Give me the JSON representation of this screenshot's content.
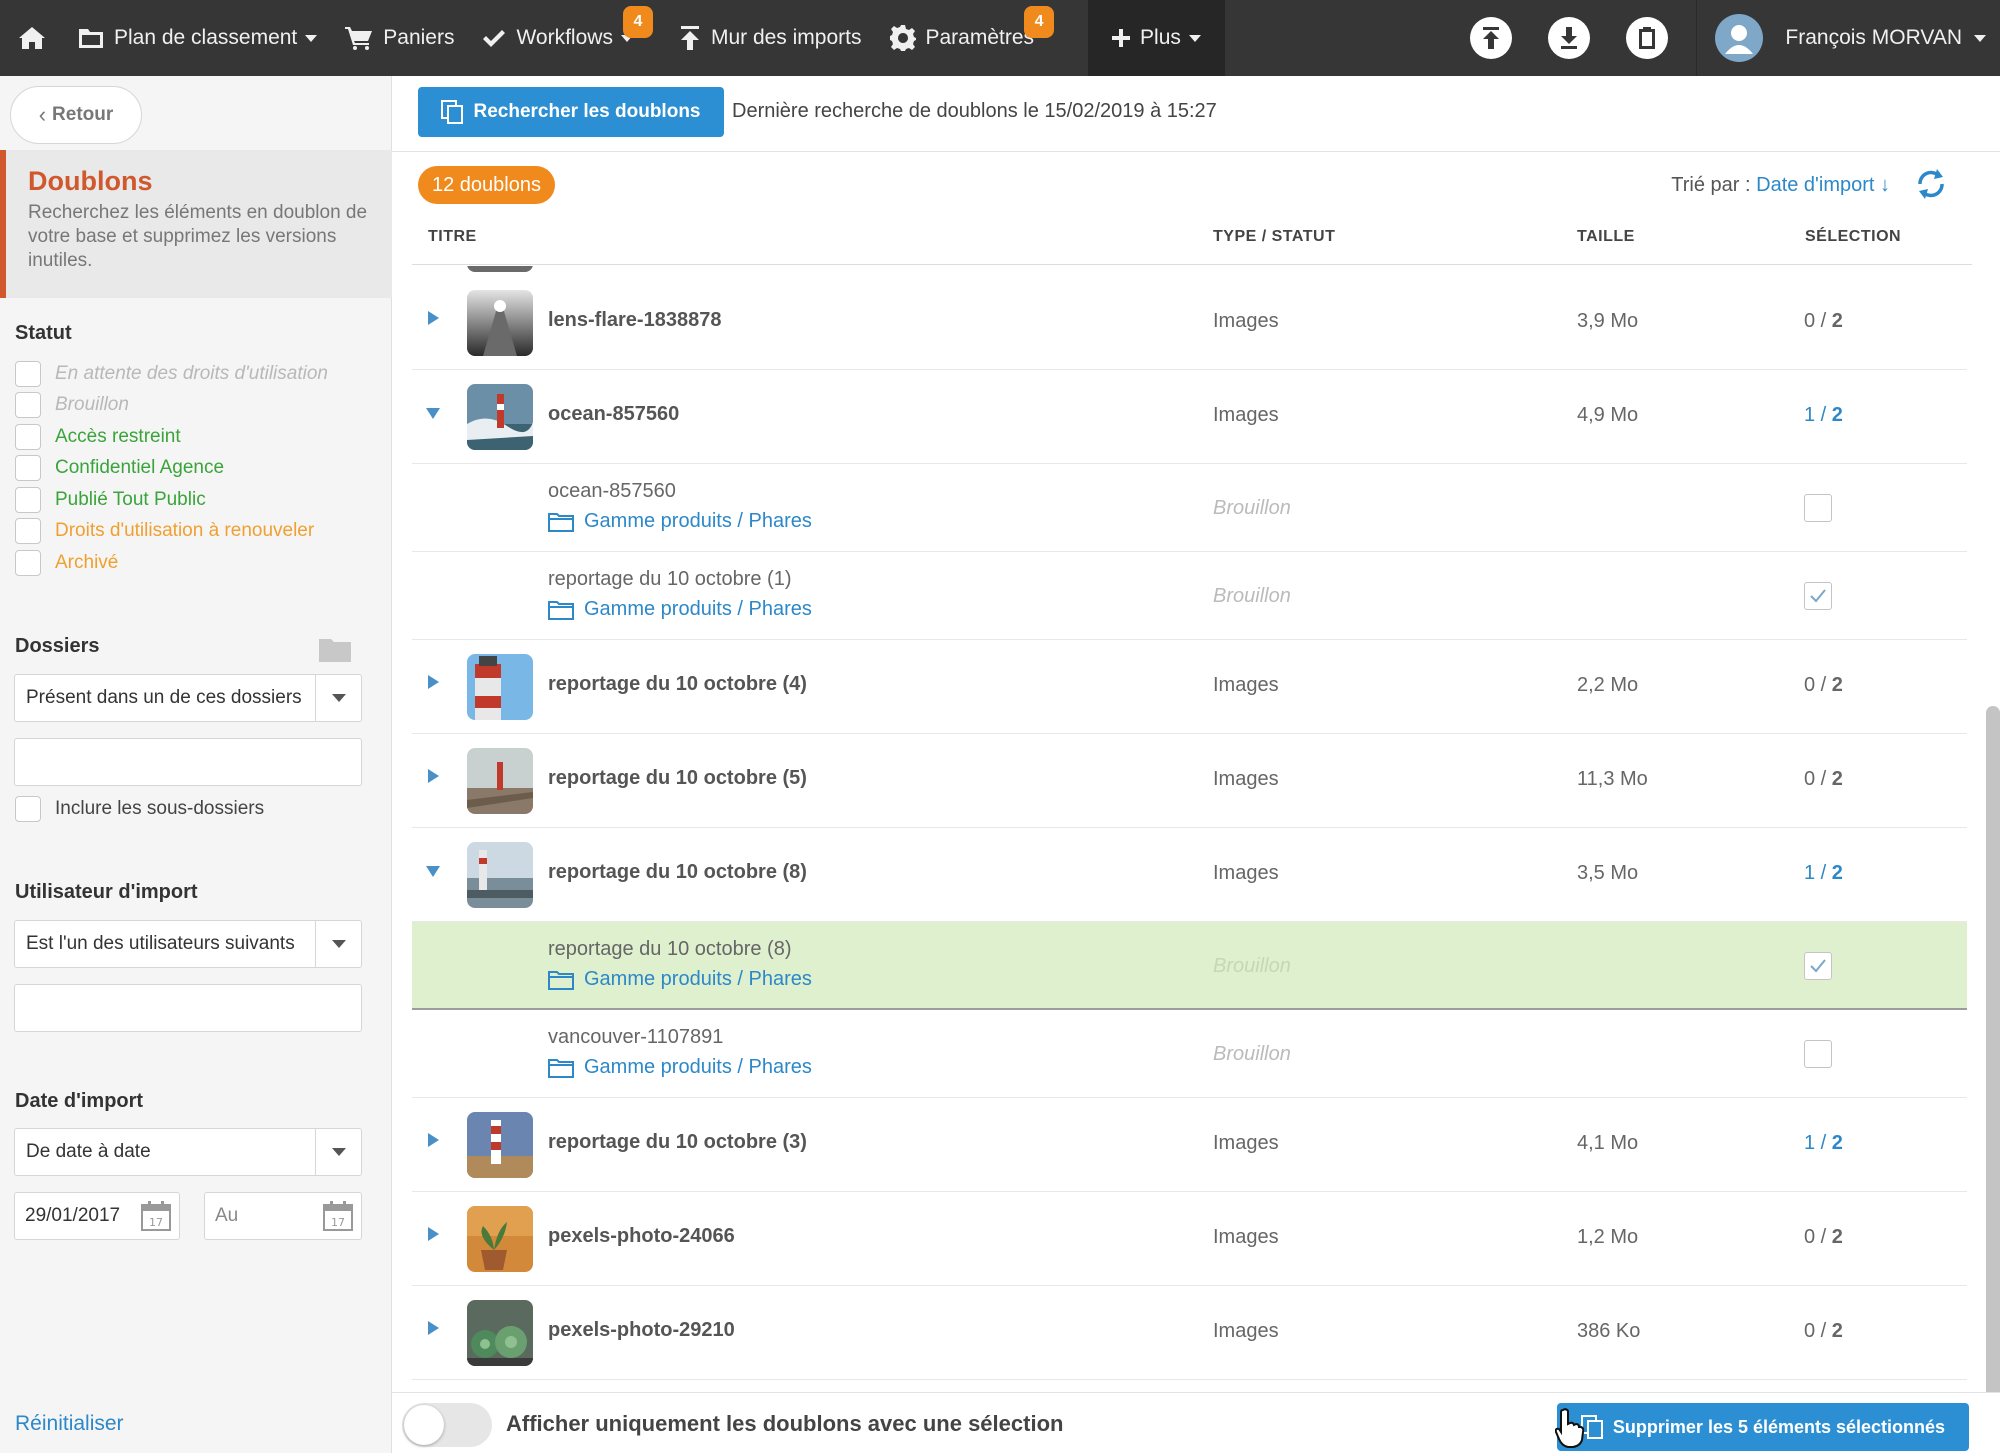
{
  "nav": {
    "items": [
      {
        "label": "Plan de classement",
        "icon": "folder-icon",
        "caret": true
      },
      {
        "label": "Paniers",
        "icon": "cart-icon",
        "caret": false
      },
      {
        "label": "Workflows",
        "icon": "check-icon",
        "caret": true,
        "badge": "4"
      },
      {
        "label": "Mur des imports",
        "icon": "upload-icon",
        "caret": false
      },
      {
        "label": "Paramètres",
        "icon": "gear-icon",
        "caret": false,
        "badge": "4"
      }
    ],
    "plus_label": "Plus",
    "user_name": "François MORVAN"
  },
  "sidebar": {
    "back_label": "Retour",
    "info_title": "Doublons",
    "info_desc": "Recherchez les éléments en doublon de votre base et supprimez les versions inutiles.",
    "status_title": "Statut",
    "statuses": [
      {
        "label": "En attente des droits d'utilisation",
        "color": "#b8b8b8",
        "italic": true
      },
      {
        "label": "Brouillon",
        "color": "#b8b8b8",
        "italic": true
      },
      {
        "label": "Accès restreint",
        "color": "#3aa43a",
        "italic": false
      },
      {
        "label": "Confidentiel Agence",
        "color": "#3aa43a",
        "italic": false
      },
      {
        "label": "Publié Tout Public",
        "color": "#3aa43a",
        "italic": false
      },
      {
        "label": "Droits d'utilisation à renouveler",
        "color": "#f0a030",
        "italic": false
      },
      {
        "label": "Archivé",
        "color": "#f0a030",
        "italic": false
      }
    ],
    "folders_title": "Dossiers",
    "folders_select": "Présent dans un de ces dossiers",
    "include_subfolders": "Inclure les sous-dossiers",
    "user_title": "Utilisateur d'import",
    "user_select": "Est l'un des utilisateurs suivants",
    "date_title": "Date d'import",
    "date_select": "De date à date",
    "date_from": "29/01/2017",
    "date_to_placeholder": "Au",
    "reset_label": "Réinitialiser"
  },
  "main": {
    "search_button": "Rechercher les doublons",
    "last_search": "Dernière recherche de doublons le 15/02/2019 à 15:27",
    "count_badge": "12 doublons",
    "sort_label": "Trié par : ",
    "sort_value": "Date d'import ↓",
    "columns": {
      "title": "TITRE",
      "type": "TYPE / STATUT",
      "size": "TAILLE",
      "selection": "SÉLECTION"
    },
    "groups": [
      {
        "title": "lens-flare-1838878",
        "type": "Images",
        "size": "3,9 Mo",
        "sel_n": "0",
        "sel_total": "2",
        "expanded": false,
        "active": false,
        "thumb": "lens",
        "children": []
      },
      {
        "title": "ocean-857560",
        "type": "Images",
        "size": "4,9 Mo",
        "sel_n": "1",
        "sel_total": "2",
        "expanded": true,
        "active": true,
        "thumb": "ocean",
        "children": [
          {
            "name": "ocean-857560",
            "path": "Gamme produits / Phares",
            "status": "Brouillon",
            "checked": false,
            "highlight": false
          },
          {
            "name": "reportage du 10 octobre (1)",
            "path": "Gamme produits / Phares",
            "status": "Brouillon",
            "checked": true,
            "highlight": false
          }
        ]
      },
      {
        "title": "reportage du 10 octobre (4)",
        "type": "Images",
        "size": "2,2 Mo",
        "sel_n": "0",
        "sel_total": "2",
        "expanded": false,
        "active": false,
        "thumb": "red",
        "children": []
      },
      {
        "title": "reportage du 10 octobre (5)",
        "type": "Images",
        "size": "11,3 Mo",
        "sel_n": "0",
        "sel_total": "2",
        "expanded": false,
        "active": false,
        "thumb": "pier",
        "children": []
      },
      {
        "title": "reportage du 10 octobre (8)",
        "type": "Images",
        "size": "3,5 Mo",
        "sel_n": "1",
        "sel_total": "2",
        "expanded": true,
        "active": true,
        "thumb": "harbor",
        "children": [
          {
            "name": "reportage du 10 octobre (8)",
            "path": "Gamme produits / Phares",
            "status": "Brouillon",
            "checked": true,
            "highlight": true
          },
          {
            "name": "vancouver-1107891",
            "path": "Gamme produits / Phares",
            "status": "Brouillon",
            "checked": false,
            "highlight": false
          }
        ]
      },
      {
        "title": "reportage du 10 octobre (3)",
        "type": "Images",
        "size": "4,1 Mo",
        "sel_n": "1",
        "sel_total": "2",
        "expanded": false,
        "active": true,
        "thumb": "stripe",
        "children": []
      },
      {
        "title": "pexels-photo-24066",
        "type": "Images",
        "size": "1,2 Mo",
        "sel_n": "0",
        "sel_total": "2",
        "expanded": false,
        "active": false,
        "thumb": "plant",
        "children": []
      },
      {
        "title": "pexels-photo-29210",
        "type": "Images",
        "size": "386 Ko",
        "sel_n": "0",
        "sel_total": "2",
        "expanded": false,
        "active": false,
        "thumb": "succulent",
        "children": []
      }
    ],
    "filter_switch_label": "Afficher uniquement les doublons avec une sélection",
    "delete_button": "Supprimer les 5 éléments sélectionnés"
  }
}
